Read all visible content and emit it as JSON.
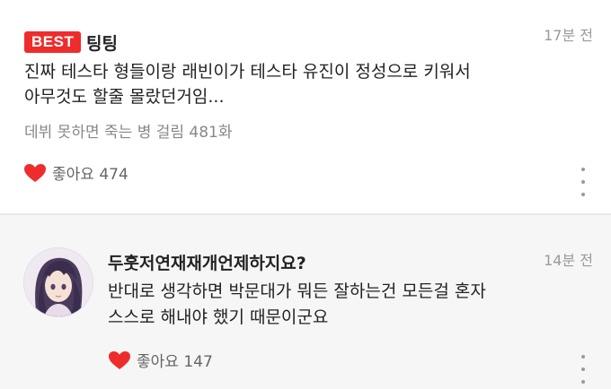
{
  "comments": [
    {
      "badge": "BEST",
      "author": "팅팅",
      "time": "17분 전",
      "lines": [
        "진짜 테스타 형들이랑 래빈이가 테스타 유진이 정성으로 키워서",
        "아무것도 할줄 몰랐던거임..."
      ],
      "webtoon_ref": "데뷔 못하면 죽는 병 걸림 481화",
      "like_label": "좋아요 474",
      "colors": {
        "badge": "#ee2c2c",
        "heart": "#ee2c2c"
      }
    },
    {
      "author": "두훗저연재재개언제하지요?",
      "time": "14분 전",
      "lines": [
        "반대로 생각하면 박문대가 뭐든 잘하는건 모든걸 혼자",
        "스스로 해내야 했기 때문이군요"
      ],
      "like_label": "좋아요 147",
      "avatar_icon": "anime-girl-avatar"
    }
  ]
}
